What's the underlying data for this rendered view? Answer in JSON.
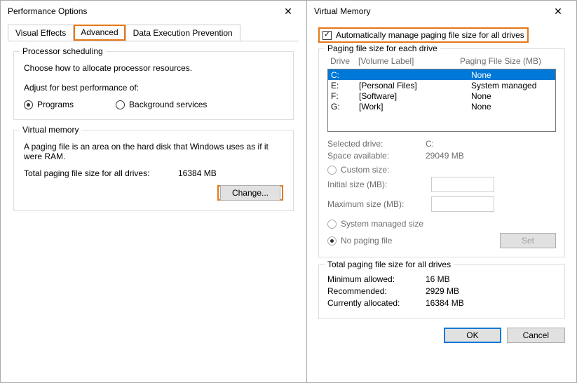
{
  "perf": {
    "title": "Performance Options",
    "tabs": [
      "Visual Effects",
      "Advanced",
      "Data Execution Prevention"
    ],
    "proc_group_title": "Processor scheduling",
    "proc_desc": "Choose how to allocate processor resources.",
    "adjust_label": "Adjust for best performance of:",
    "radio_programs": "Programs",
    "radio_bg": "Background services",
    "vm_group_title": "Virtual memory",
    "vm_desc": "A paging file is an area on the hard disk that Windows uses as if it were RAM.",
    "total_label": "Total paging file size for all drives:",
    "total_value": "16384 MB",
    "change_btn": "Change..."
  },
  "vm": {
    "title": "Virtual Memory",
    "auto_label": "Automatically manage paging file size for all drives",
    "drive_group_title": "Paging file size for each drive",
    "header_drive": "Drive",
    "header_label": "[Volume Label]",
    "header_size": "Paging File Size (MB)",
    "drives": [
      {
        "d": "C:",
        "label": "",
        "size": "None",
        "selected": true
      },
      {
        "d": "E:",
        "label": "[Personal Files]",
        "size": "System managed",
        "selected": false
      },
      {
        "d": "F:",
        "label": "[Software]",
        "size": "None",
        "selected": false
      },
      {
        "d": "G:",
        "label": "[Work]",
        "size": "None",
        "selected": false
      }
    ],
    "selected_drive_label": "Selected drive:",
    "selected_drive_value": "C:",
    "space_label": "Space available:",
    "space_value": "29049 MB",
    "custom_label": "Custom size:",
    "initial_label": "Initial size (MB):",
    "max_label": "Maximum size (MB):",
    "sysman_label": "System managed size",
    "nopage_label": "No paging file",
    "set_btn": "Set",
    "total_group_title": "Total paging file size for all drives",
    "min_label": "Minimum allowed:",
    "min_value": "16 MB",
    "rec_label": "Recommended:",
    "rec_value": "2929 MB",
    "cur_label": "Currently allocated:",
    "cur_value": "16384 MB",
    "ok_btn": "OK",
    "cancel_btn": "Cancel"
  }
}
